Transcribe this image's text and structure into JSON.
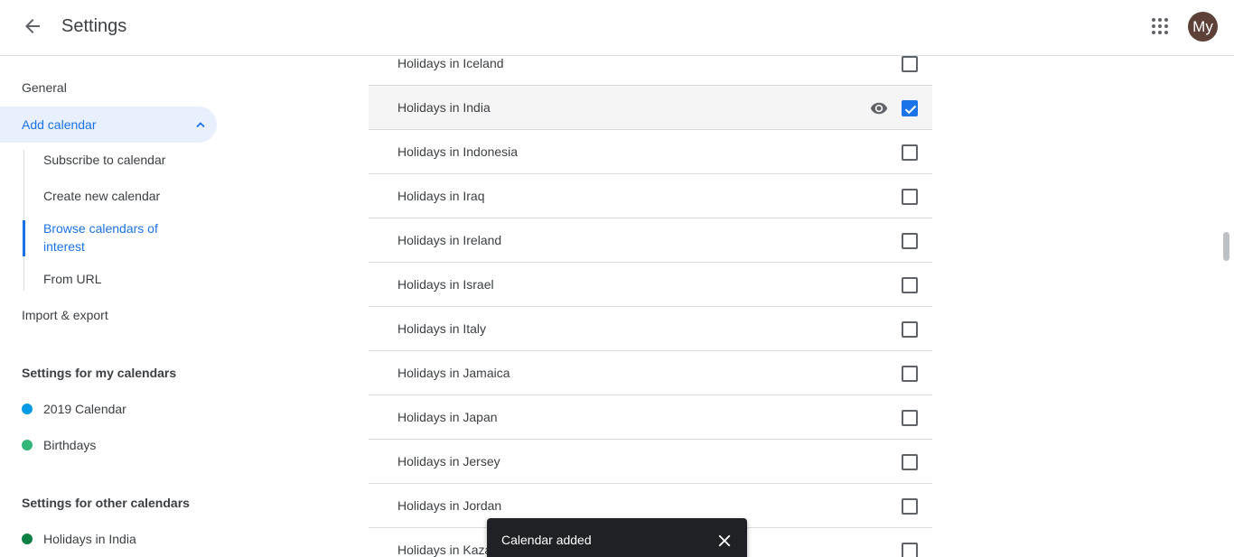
{
  "header": {
    "title": "Settings",
    "avatar_initials": "My",
    "avatar_color": "#5d4037"
  },
  "sidebar": {
    "general": "General",
    "add_calendar": "Add calendar",
    "sub_items": [
      "Subscribe to calendar",
      "Create new calendar",
      "Browse calendars of interest",
      "From URL"
    ],
    "import_export": "Import & export",
    "my_calendars_heading": "Settings for my calendars",
    "my_calendars": [
      {
        "name": "2019 Calendar",
        "color": "#039be5"
      },
      {
        "name": "Birthdays",
        "color": "#33b679"
      }
    ],
    "other_calendars_heading": "Settings for other calendars",
    "other_calendars": [
      {
        "name": "Holidays in India",
        "color": "#0b8043"
      }
    ]
  },
  "list": {
    "rows": [
      {
        "label": "Holidays in Iceland",
        "checked": false
      },
      {
        "label": "Holidays in India",
        "checked": true
      },
      {
        "label": "Holidays in Indonesia",
        "checked": false
      },
      {
        "label": "Holidays in Iraq",
        "checked": false
      },
      {
        "label": "Holidays in Ireland",
        "checked": false
      },
      {
        "label": "Holidays in Israel",
        "checked": false
      },
      {
        "label": "Holidays in Italy",
        "checked": false
      },
      {
        "label": "Holidays in Jamaica",
        "checked": false
      },
      {
        "label": "Holidays in Japan",
        "checked": false
      },
      {
        "label": "Holidays in Jersey",
        "checked": false
      },
      {
        "label": "Holidays in Jordan",
        "checked": false
      },
      {
        "label": "Holidays in Kazakhstan",
        "checked": false
      }
    ]
  },
  "snackbar": {
    "message": "Calendar added"
  },
  "colors": {
    "accent": "#1a73e8",
    "active_bg": "#e8f0fe"
  }
}
